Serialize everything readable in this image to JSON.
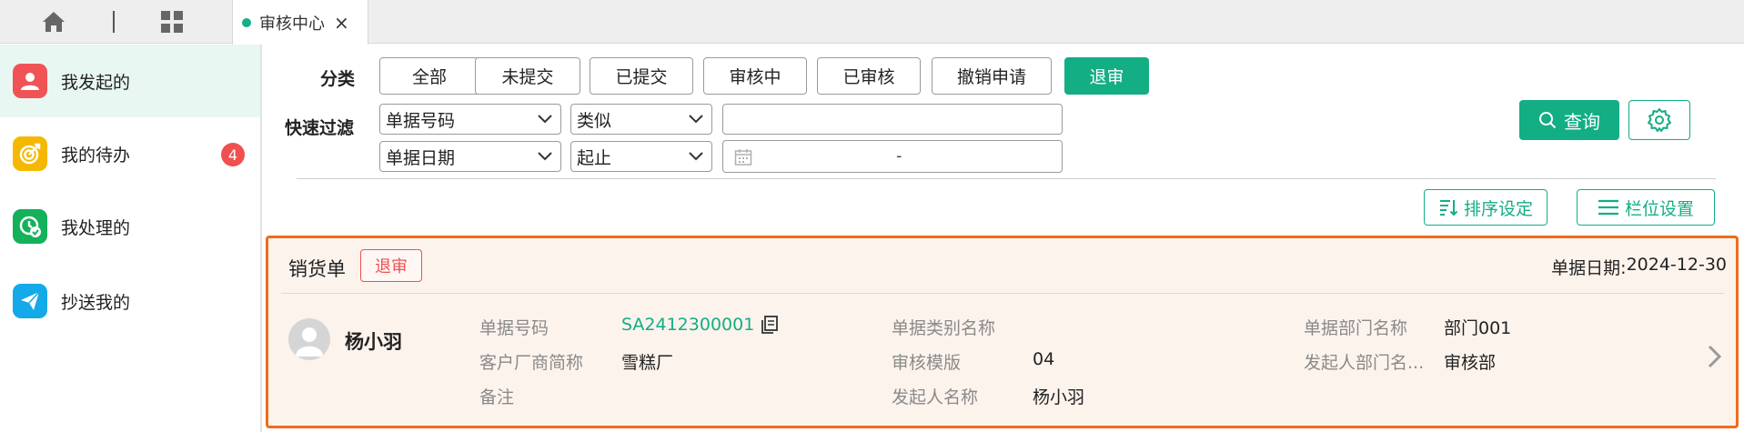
{
  "tabs": [
    {
      "label": "审核中心",
      "close": "×"
    }
  ],
  "sidebar": {
    "items": [
      {
        "label": "我发起的",
        "icon": "user-icon",
        "color": "#f05356"
      },
      {
        "label": "我的待办",
        "icon": "target-icon",
        "color": "#f5b800",
        "badge": "4"
      },
      {
        "label": "我处理的",
        "icon": "clock-check-icon",
        "color": "#14b15b"
      },
      {
        "label": "抄送我的",
        "icon": "send-icon",
        "color": "#14a9e8"
      }
    ]
  },
  "filter": {
    "category_label": "分类",
    "categories": [
      "全部",
      "未提交",
      "已提交",
      "审核中",
      "已审核",
      "撤销申请",
      "退审"
    ],
    "selected_category": "退审",
    "quick_label": "快速过滤",
    "row1": {
      "field": "单据号码",
      "operator": "类似",
      "value": ""
    },
    "row2": {
      "field": "单据日期",
      "operator": "起止",
      "range_separator": "-"
    },
    "query_label": "查询"
  },
  "toolbar": {
    "sort_label": "排序设定",
    "columns_label": "栏位设置"
  },
  "record": {
    "type": "销货单",
    "status": "退审",
    "date_label": "单据日期:",
    "date": "2024-12-30",
    "person": "杨小羽",
    "fields": {
      "doc_no_label": "单据号码",
      "doc_no": "SA2412300001",
      "customer_label": "客户厂商简称",
      "customer": "雪糕厂",
      "note_label": "备注",
      "note": "",
      "doc_type_name_label": "单据类别名称",
      "doc_type_name": "",
      "template_label": "审核模版",
      "template": "04",
      "initiator_label": "发起人名称",
      "initiator": "杨小羽",
      "dept_label": "单据部门名称",
      "dept": "部门001",
      "initiator_dept_label": "发起人部门名...",
      "initiator_dept": "审核部"
    }
  },
  "colors": {
    "accent": "#13ae84",
    "danger": "#f05050",
    "highlight_border": "#f06b1c"
  }
}
